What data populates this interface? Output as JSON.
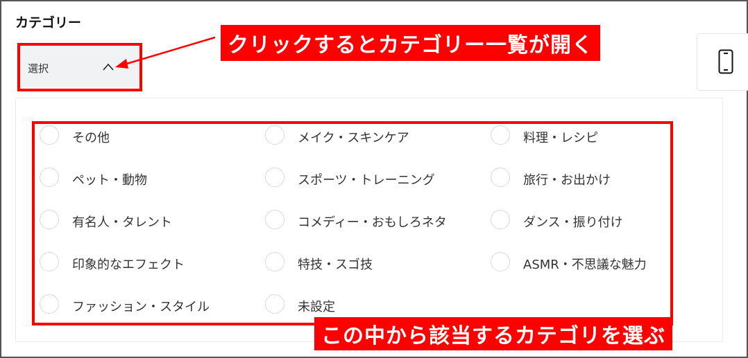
{
  "section": {
    "title": "カテゴリー"
  },
  "select": {
    "value": "選択",
    "chevron_icon": "chevron-up-icon",
    "expanded": true
  },
  "annotations": {
    "callout_select": "クリックするとカテゴリー一覧が開く",
    "callout_list": "この中から該当するカテゴリを選ぶ",
    "highlight_color": "#ff0000"
  },
  "side_tile": {
    "icon": "smartphone-icon"
  },
  "categories": [
    {
      "label": "その他",
      "checked": false
    },
    {
      "label": "メイク・スキンケア",
      "checked": false
    },
    {
      "label": "料理・レシピ",
      "checked": false
    },
    {
      "label": "ペット・動物",
      "checked": false
    },
    {
      "label": "スポーツ・トレーニング",
      "checked": false
    },
    {
      "label": "旅行・お出かけ",
      "checked": false
    },
    {
      "label": "有名人・タレント",
      "checked": false
    },
    {
      "label": "コメディー・おもしろネタ",
      "checked": false
    },
    {
      "label": "ダンス・振り付け",
      "checked": false
    },
    {
      "label": "印象的なエフェクト",
      "checked": false
    },
    {
      "label": "特技・スゴ技",
      "checked": false
    },
    {
      "label": "ASMR・不思議な魅力",
      "checked": false
    },
    {
      "label": "ファッション・スタイル",
      "checked": false
    },
    {
      "label": "未設定",
      "checked": false
    }
  ]
}
